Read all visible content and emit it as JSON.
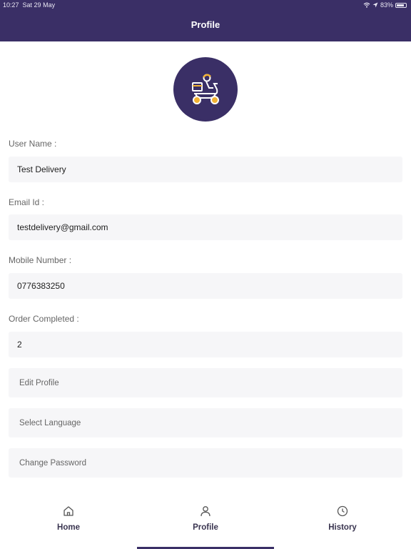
{
  "status_bar": {
    "time": "10:27",
    "date": "Sat 29 May",
    "battery": "83%"
  },
  "header": {
    "title": "Profile"
  },
  "profile": {
    "fields": [
      {
        "label": "User Name :",
        "value": "Test Delivery"
      },
      {
        "label": "Email Id :",
        "value": "testdelivery@gmail.com"
      },
      {
        "label": "Mobile Number :",
        "value": "0776383250"
      },
      {
        "label": "Order Completed :",
        "value": "2"
      }
    ],
    "actions": [
      {
        "label": "Edit Profile"
      },
      {
        "label": "Select Language"
      },
      {
        "label": "Change Password"
      }
    ]
  },
  "tabs": [
    {
      "label": "Home",
      "icon": "home-icon"
    },
    {
      "label": "Profile",
      "icon": "user-icon"
    },
    {
      "label": "History",
      "icon": "clock-icon"
    }
  ],
  "colors": {
    "primary": "#3a2f66",
    "accent": "#f2b233",
    "field_bg": "#f6f6f8"
  }
}
